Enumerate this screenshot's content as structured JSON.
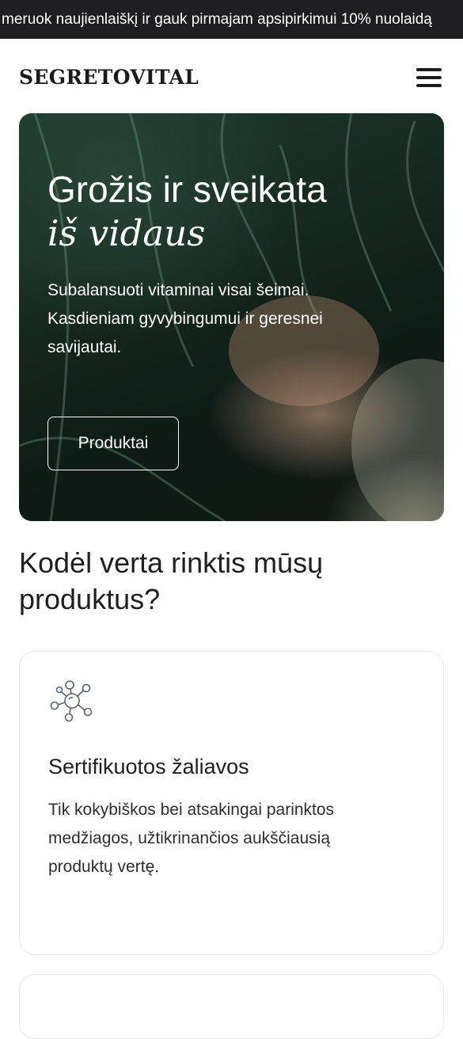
{
  "announcement": {
    "text": "meruok naujienlaiškį ir gauk pirmajam apsipirkimui 10% nuolaidą"
  },
  "header": {
    "logo": "SEGRETOVITAL",
    "menu_icon": "hamburger-menu-icon"
  },
  "hero": {
    "title_line1": "Grožis ir sveikata",
    "title_line2": "iš vidaus",
    "subtitle": "Subalansuoti vitaminai visai šeimai. Kasdieniam gyvybingumui ir geresnei savijautai.",
    "button_label": "Produktai"
  },
  "why": {
    "title": "Kodėl verta rinktis mūsų produktus?",
    "cards": [
      {
        "icon": "molecule-icon",
        "title": "Sertifikuotos žaliavos",
        "text": "Tik kokybiškos bei atsakingai parinktos medžiagos, užtikrinančios aukščiausią produktų vertę."
      }
    ]
  },
  "colors": {
    "announcement_bg": "#1e1e20",
    "text": "#1f1f1f",
    "card_border": "#e6e6e6",
    "icon_stroke": "#5a6470"
  }
}
